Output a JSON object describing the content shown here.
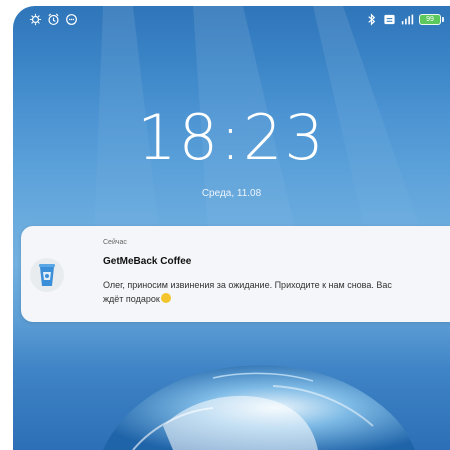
{
  "status_bar": {
    "left_icons": [
      "settings-gear-icon",
      "alarm-icon",
      "message-icon"
    ],
    "right_icons": [
      "bluetooth-icon",
      "data-transfer-icon",
      "signal-icon",
      "battery-icon"
    ],
    "battery_label": "99"
  },
  "lock_screen": {
    "time": "18:23",
    "date": "Среда, 11.08"
  },
  "notification": {
    "time_label": "Сейчас",
    "app_title": "GetMeBack Coffee",
    "message": "Олег, приносим извинения за ожидание. Приходите к нам снова. Вас ждёт подарок",
    "emoji": "smiling-face-icon",
    "colors": {
      "card": "#f4f6f9",
      "cup": "#3a8fd8"
    }
  },
  "wallpaper": {
    "colors": {
      "top": "#2f75b9",
      "mid": "#72b0df",
      "water": "#1f63a8"
    }
  }
}
